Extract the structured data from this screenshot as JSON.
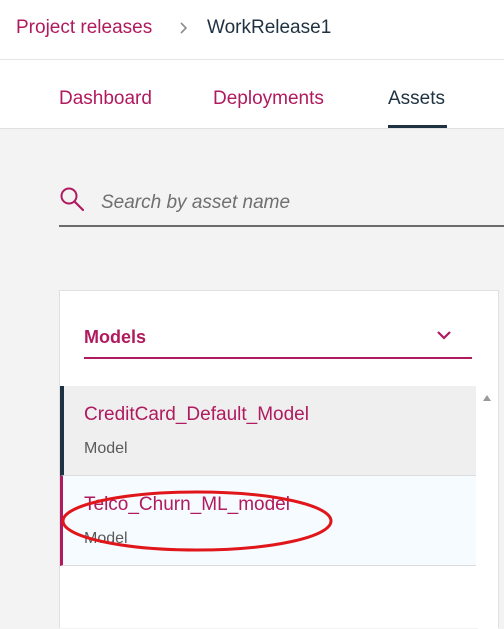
{
  "breadcrumb": {
    "parent": "Project releases",
    "current": "WorkRelease1"
  },
  "tabs": [
    {
      "label": "Dashboard",
      "active": false
    },
    {
      "label": "Deployments",
      "active": false
    },
    {
      "label": "Assets",
      "active": true
    }
  ],
  "search": {
    "placeholder": "Search by asset name",
    "value": ""
  },
  "assets_panel": {
    "filter_selected": "Models",
    "items": [
      {
        "name": "CreditCard_Default_Model",
        "type": "Model",
        "selected": true
      },
      {
        "name": "Telco_Churn_ML_model",
        "type": "Model",
        "selected": false
      }
    ]
  },
  "colors": {
    "accent": "#b01a5f",
    "dark": "#1f3241",
    "annotation": "#e0161b"
  },
  "icons": {
    "breadcrumb_separator": "chevron-right-icon",
    "search": "search-icon",
    "dropdown": "chevron-down-icon",
    "scroll": "scroll-up-arrow-icon"
  }
}
